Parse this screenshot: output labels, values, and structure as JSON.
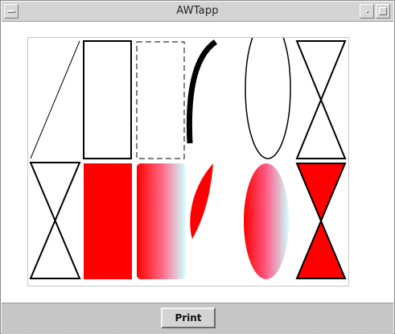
{
  "window": {
    "title": "AWTapp"
  },
  "toolbar": {
    "print_label": "Print"
  },
  "icons": {
    "window_menu": "window-menu-icon",
    "minimize": "minimize-icon",
    "maximize": "maximize-icon"
  },
  "colors": {
    "fill": "#ff0000",
    "stroke": "#000000",
    "gradient_start": "#ff0000",
    "gradient_end": "#ccffff"
  },
  "shapes": {
    "top_row": [
      "line",
      "rectangle",
      "dashed-rectangle",
      "thick-arc",
      "ellipse",
      "hourglass-outline"
    ],
    "bottom_row": [
      "hourglass-outline",
      "filled-rectangle",
      "gradient-rectangle",
      "filled-arc",
      "gradient-ellipse",
      "filled-hourglass"
    ]
  }
}
